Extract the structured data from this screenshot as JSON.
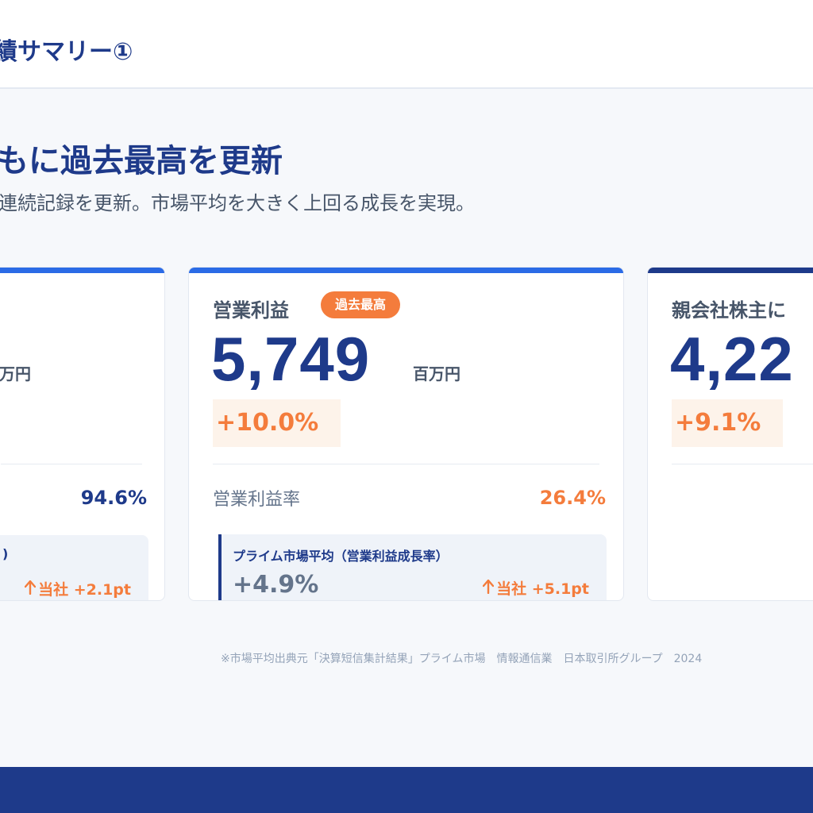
{
  "header": {
    "title": "績サマリー①"
  },
  "headline": {
    "title": "もに過去最高を更新",
    "subtitle": "連続記録を更新。市場平均を大きく上回る成長を実現。"
  },
  "colors": {
    "primary": "#1e3a8a",
    "accent": "#f47c3c",
    "accent_blue": "#2b6be6"
  },
  "cards": {
    "left": {
      "unit": "百万円",
      "ratio_value": "94.6%",
      "bench_partial": ")",
      "bench_compare": "当社 +2.1pt",
      "bench_icon": "arrow-up-icon"
    },
    "middle": {
      "title": "営業利益",
      "badge": "過去最高",
      "value": "5,749",
      "unit": "百万円",
      "growth": "+10.0%",
      "ratio_label": "営業利益率",
      "ratio_value": "26.4%",
      "bench_label": "プライム市場平均（営業利益成長率）",
      "bench_value": "+4.9%",
      "bench_compare": "当社 +5.1pt",
      "bench_icon": "arrow-up-icon"
    },
    "right": {
      "title": "親会社株主に",
      "value": "4,22",
      "growth": "+9.1%"
    }
  },
  "footnote": "※市場平均出典元「決算短信集計結果」プライム市場　情報通信業　日本取引所グループ　2024"
}
